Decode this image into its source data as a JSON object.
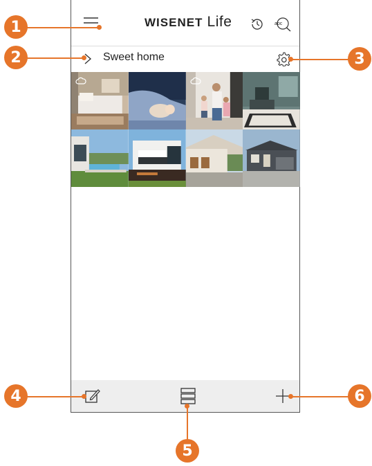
{
  "app": {
    "brand_wordmark": "WISENET",
    "brand_name": "Life"
  },
  "home": {
    "title": "Sweet home"
  },
  "icons": {
    "menu": "menu-icon",
    "history": "history-icon",
    "search": "text-search-icon",
    "expand": "chevron-right-icon",
    "settings": "gear-icon",
    "edit": "edit-icon",
    "layout": "list-layout-icon",
    "add": "plus-icon"
  },
  "callouts": [
    "1",
    "2",
    "3",
    "4",
    "5",
    "6"
  ],
  "colors": {
    "accent": "#e6752a"
  }
}
